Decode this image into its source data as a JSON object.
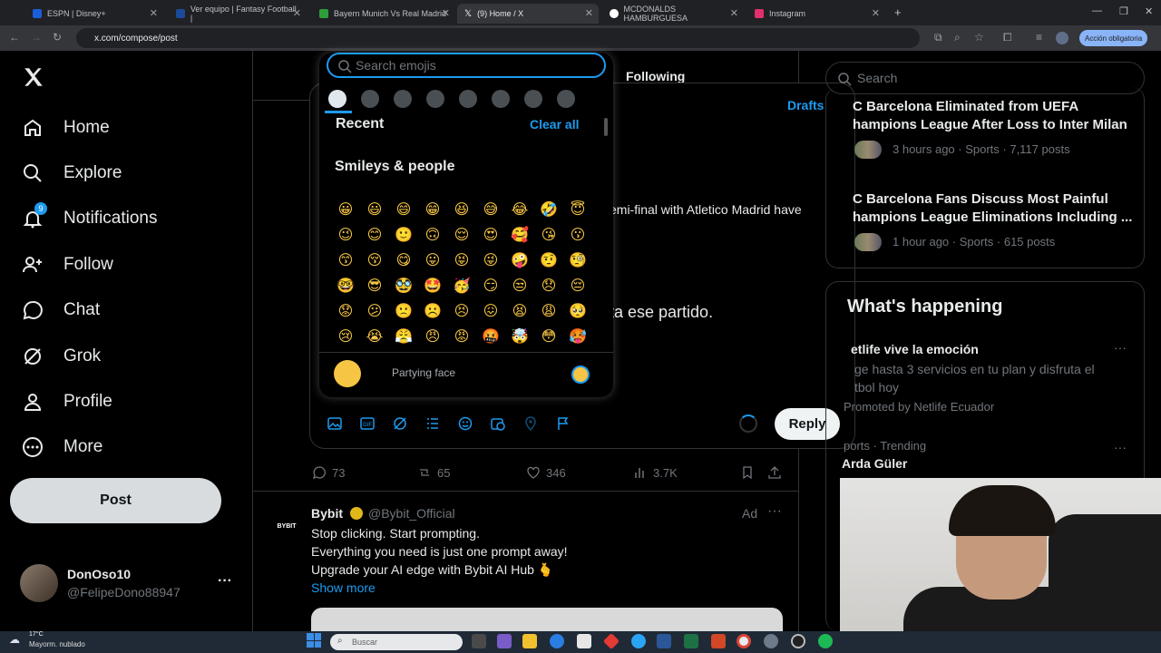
{
  "browser": {
    "tabs": [
      {
        "title": "ESPN | Disney+",
        "color": "#1a5ed8"
      },
      {
        "title": "Ver equipo | Fantasy Football |",
        "color": "#1c4a9a"
      },
      {
        "title": "Bayern Munich Vs Real Madrid",
        "color": "#2d9e3a"
      },
      {
        "title": "(9) Home / X",
        "color": "#ffffff"
      },
      {
        "title": "MCDONALDS HAMBURGUESA",
        "color": "#ffffff"
      },
      {
        "title": "Instagram",
        "color": "#e1306c"
      }
    ],
    "url": "x.com/compose/post",
    "action_button": "Acción obligatoria"
  },
  "sidebar": {
    "items": [
      {
        "label": "Home",
        "icon": "home-icon"
      },
      {
        "label": "Explore",
        "icon": "search-icon"
      },
      {
        "label": "Notifications",
        "icon": "bell-icon",
        "badge": "9"
      },
      {
        "label": "Follow",
        "icon": "person-plus-icon"
      },
      {
        "label": "Chat",
        "icon": "chat-icon"
      },
      {
        "label": "Grok",
        "icon": "grok-icon"
      },
      {
        "label": "Profile",
        "icon": "person-icon"
      },
      {
        "label": "More",
        "icon": "more-circle-icon"
      }
    ],
    "post_label": "Post",
    "account": {
      "name": "DonOso10",
      "handle": "@FelipeDono88947",
      "more": "···"
    }
  },
  "timeline": {
    "tab_following": "Following"
  },
  "compose": {
    "drafts": "Drafts",
    "context_text": "emi-final with Atletico Madrid have",
    "draft_text": "ta ese partido.",
    "reply_label": "Reply"
  },
  "emoji_picker": {
    "search_placeholder": "Search emojis",
    "recent_label": "Recent",
    "clear_all": "Clear all",
    "section_label": "Smileys & people",
    "preview_name": "Partying face",
    "emojis": [
      "😀",
      "😃",
      "😄",
      "😁",
      "😆",
      "😅",
      "😂",
      "🤣",
      "😇",
      "😉",
      "😊",
      "🙂",
      "🙃",
      "😌",
      "😍",
      "🥰",
      "😘",
      "😗",
      "😙",
      "😚",
      "😋",
      "😛",
      "😝",
      "😜",
      "🤪",
      "🤨",
      "🧐",
      "🤓",
      "😎",
      "🥸",
      "🤩",
      "🥳",
      "😏",
      "😒",
      "😞",
      "😔",
      "😟",
      "😕",
      "🙁",
      "☹️",
      "😣",
      "😖",
      "😫",
      "😩",
      "🥺",
      "😢",
      "😭",
      "😤",
      "😠",
      "😡",
      "🤬",
      "🤯",
      "😳",
      "🥵"
    ]
  },
  "tweet_stats": {
    "replies": "73",
    "reposts": "65",
    "likes": "346",
    "views": "3.7K"
  },
  "ad_tweet": {
    "logo": "BYBIT",
    "name": "Bybit",
    "handle": "@Bybit_Official",
    "ad_label": "Ad",
    "more": "···",
    "lines": [
      "Stop clicking. Start prompting.",
      "Everything you need is just one prompt away!",
      "Upgrade your AI edge with Bybit AI Hub 🫰"
    ],
    "show_more": "Show more"
  },
  "right_column": {
    "search_placeholder": "Search",
    "news": [
      {
        "title_1": "C Barcelona Eliminated from UEFA",
        "title_2": "hampions League After Loss to Inter Milan",
        "meta": "3 hours ago · Sports · 7,117 posts"
      },
      {
        "title_1": "C Barcelona Fans Discuss Most Painful",
        "title_2": "hampions League Eliminations Including ...",
        "meta": "1 hour ago · Sports · 615 posts"
      }
    ],
    "happening_title": "What's happening",
    "promo": {
      "title": "etlife vive la emoción",
      "text_1": "ge hasta 3 servicios en tu plan y disfruta el",
      "text_2": "tbol hoy",
      "promoted": "Promoted by Netlife Ecuador"
    },
    "trend": {
      "meta": "ports · Trending",
      "name": "Arda Güler"
    },
    "dots": "···"
  },
  "taskbar": {
    "weather_temp": "17°C",
    "weather_desc": "Mayorm. nublado",
    "search_placeholder": "Buscar"
  }
}
